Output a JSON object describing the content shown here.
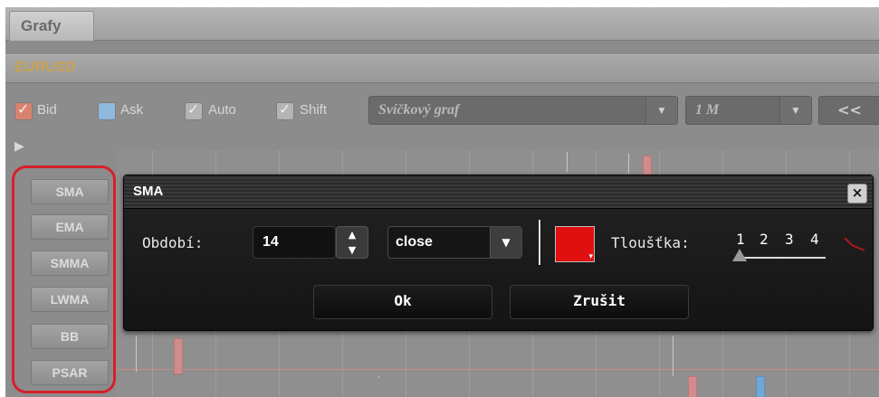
{
  "tab": {
    "title": "Grafy"
  },
  "instrument": {
    "symbol": "EURUSD"
  },
  "toolbar": {
    "bid_label": "Bid",
    "ask_label": "Ask",
    "auto_label": "Auto",
    "shift_label": "Shift",
    "chart_type": "Svíčkový graf",
    "timeframe": "1 M",
    "back_label": "<<",
    "bid_checked": true,
    "ask_checked": false,
    "auto_checked": true,
    "shift_checked": true
  },
  "indicators": {
    "items": [
      "SMA",
      "EMA",
      "SMMA",
      "LWMA",
      "BB",
      "PSAR"
    ]
  },
  "dialog": {
    "title": "SMA",
    "close_symbol": "×",
    "period_label": "Období:",
    "period_value": "14",
    "price_value": "close",
    "color": "#e01010",
    "thickness_label": "Tloušťka:",
    "thickness_options": [
      "1",
      "2",
      "3",
      "4"
    ],
    "thickness_selected": "1",
    "ok_label": "Ok",
    "cancel_label": "Zrušit"
  },
  "colors": {
    "highlight": "#d6202b",
    "accent_red": "#e01010"
  }
}
